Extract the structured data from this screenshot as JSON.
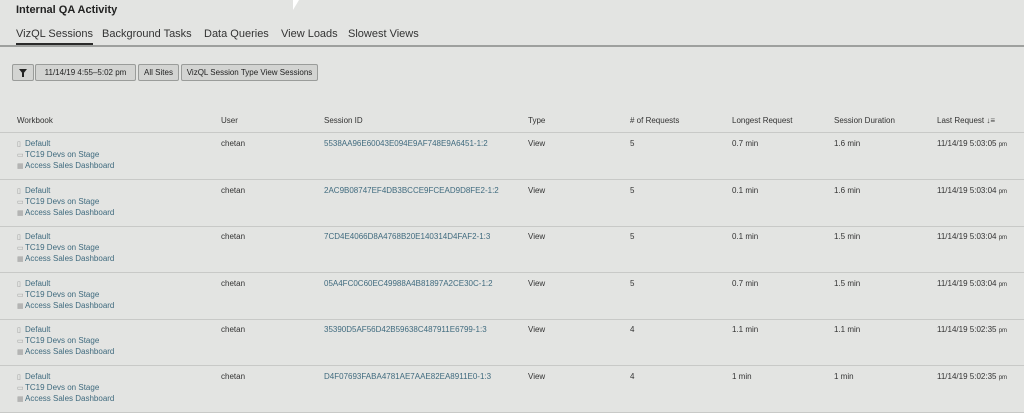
{
  "app": {
    "title": "Internal QA Activity"
  },
  "tabs": [
    {
      "label": "VizQL Sessions",
      "active": true
    },
    {
      "label": "Background Tasks"
    },
    {
      "label": "Data Queries"
    },
    {
      "label": "View Loads"
    },
    {
      "label": "Slowest Views"
    }
  ],
  "filters": {
    "date_range": "11/14/19 4:55–5:02 pm",
    "sites": "All Sites",
    "session_type": "VizQL Session Type View Sessions"
  },
  "table": {
    "headers": {
      "workbook": "Workbook",
      "user": "User",
      "session_id": "Session ID",
      "type": "Type",
      "requests": "# of Requests",
      "longest": "Longest Request",
      "duration": "Session Duration",
      "last_request": "Last Request"
    },
    "rows": [
      {
        "site": "Default",
        "project": "TC19 Devs on Stage",
        "view": "Access Sales Dashboard",
        "user": "chetan",
        "session_id": "5538AA96E60043E094E9AF748E9A6451-1:2",
        "type": "View",
        "requests": "5",
        "longest": "0.7 min",
        "duration": "1.6 min",
        "last_request": "11/14/19 5:03:05",
        "ampm": "pm"
      },
      {
        "site": "Default",
        "project": "TC19 Devs on Stage",
        "view": "Access Sales Dashboard",
        "user": "chetan",
        "session_id": "2AC9B08747EF4DB3BCCE9FCEAD9D8FE2-1:2",
        "type": "View",
        "requests": "5",
        "longest": "0.1 min",
        "duration": "1.6 min",
        "last_request": "11/14/19 5:03:04",
        "ampm": "pm"
      },
      {
        "site": "Default",
        "project": "TC19 Devs on Stage",
        "view": "Access Sales Dashboard",
        "user": "chetan",
        "session_id": "7CD4E4066D8A4768B20E140314D4FAF2-1:3",
        "type": "View",
        "requests": "5",
        "longest": "0.1 min",
        "duration": "1.5 min",
        "last_request": "11/14/19 5:03:04",
        "ampm": "pm"
      },
      {
        "site": "Default",
        "project": "TC19 Devs on Stage",
        "view": "Access Sales Dashboard",
        "user": "chetan",
        "session_id": "05A4FC0C60EC49988A4B81897A2CE30C-1:2",
        "type": "View",
        "requests": "5",
        "longest": "0.7 min",
        "duration": "1.5 min",
        "last_request": "11/14/19 5:03:04",
        "ampm": "pm"
      },
      {
        "site": "Default",
        "project": "TC19 Devs on Stage",
        "view": "Access Sales Dashboard",
        "user": "chetan",
        "session_id": "35390D5AF56D42B59638C487911E6799-1:3",
        "type": "View",
        "requests": "4",
        "longest": "1.1 min",
        "duration": "1.1 min",
        "last_request": "11/14/19 5:02:35",
        "ampm": "pm"
      },
      {
        "site": "Default",
        "project": "TC19 Devs on Stage",
        "view": "Access Sales Dashboard",
        "user": "chetan",
        "session_id": "D4F07693FABA4781AE7AAE82EA8911E0-1:3",
        "type": "View",
        "requests": "4",
        "longest": "1 min",
        "duration": "1 min",
        "last_request": "11/14/19 5:02:35",
        "ampm": "pm"
      }
    ]
  }
}
